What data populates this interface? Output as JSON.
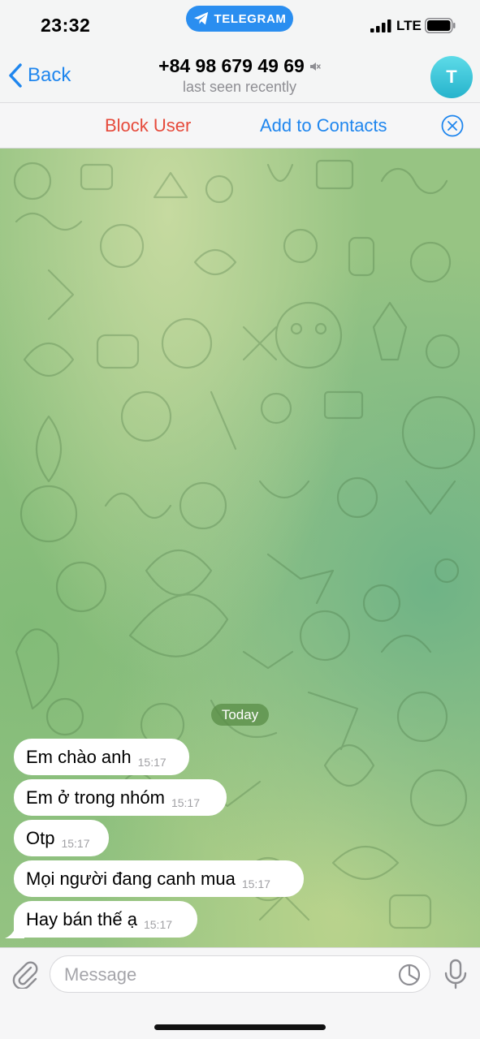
{
  "status_bar": {
    "time": "23:32",
    "app_pill": "TELEGRAM",
    "network": "LTE"
  },
  "nav": {
    "back_label": "Back",
    "title": "+84 98 679 49 69",
    "subtitle": "last seen recently",
    "avatar_initial": "T",
    "muted_icon": "muted-speaker-icon"
  },
  "actions": {
    "block_label": "Block User",
    "add_label": "Add to Contacts"
  },
  "chat": {
    "date_label": "Today",
    "messages": [
      {
        "text": "Em chào anh",
        "time": "15:17"
      },
      {
        "text": "Em ở trong nhóm",
        "time": "15:17"
      },
      {
        "text": "Otp",
        "time": "15:17"
      },
      {
        "text": "Mọi người đang canh mua",
        "time": "15:17"
      },
      {
        "text": "Hay bán thế ạ",
        "time": "15:17"
      }
    ]
  },
  "composer": {
    "placeholder": "Message",
    "value": ""
  },
  "colors": {
    "accent": "#1f86ee",
    "danger": "#e64a3b",
    "telegram_pill": "#2a8ef0"
  }
}
